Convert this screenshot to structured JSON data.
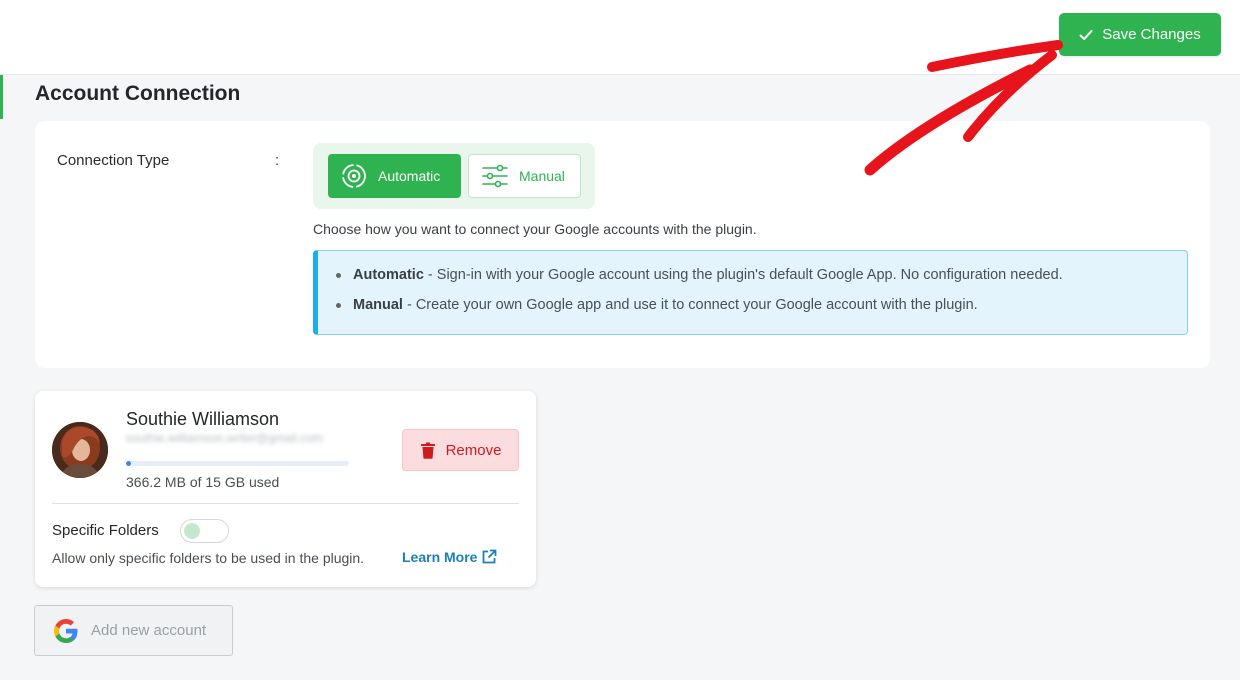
{
  "header": {
    "save_label": "Save Changes"
  },
  "section": {
    "title": "Account Connection"
  },
  "connection": {
    "label": "Connection Type",
    "colon": ":",
    "options": [
      {
        "label": "Automatic",
        "icon": "sync-icon",
        "selected": true
      },
      {
        "label": "Manual",
        "icon": "sliders-icon",
        "selected": false
      }
    ],
    "description": "Choose how you want to connect your Google accounts with the plugin.",
    "info": [
      {
        "term": "Automatic",
        "text": " - Sign-in with your Google account using the plugin's default Google App. No configuration needed."
      },
      {
        "term": "Manual",
        "text": " - Create your own Google app and use it to connect your Google account with the plugin."
      }
    ]
  },
  "account": {
    "name": "Southie Williamson",
    "email": "southie.williamson.writer@gmail.com",
    "storage_used_fraction": 0.024,
    "storage_text": "366.2 MB of 15 GB used",
    "remove_label": "Remove",
    "specific_folders_label": "Specific Folders",
    "specific_folders_enabled": false,
    "specific_folders_desc": "Allow only specific folders to be used in the plugin.",
    "learn_more_label": "Learn More"
  },
  "add_account": {
    "label": "Add new account"
  },
  "colors": {
    "accent_green": "#2fb350",
    "info_blue": "#1eaee6",
    "danger_red": "#d0191f",
    "annotation_red": "#e8141b"
  }
}
